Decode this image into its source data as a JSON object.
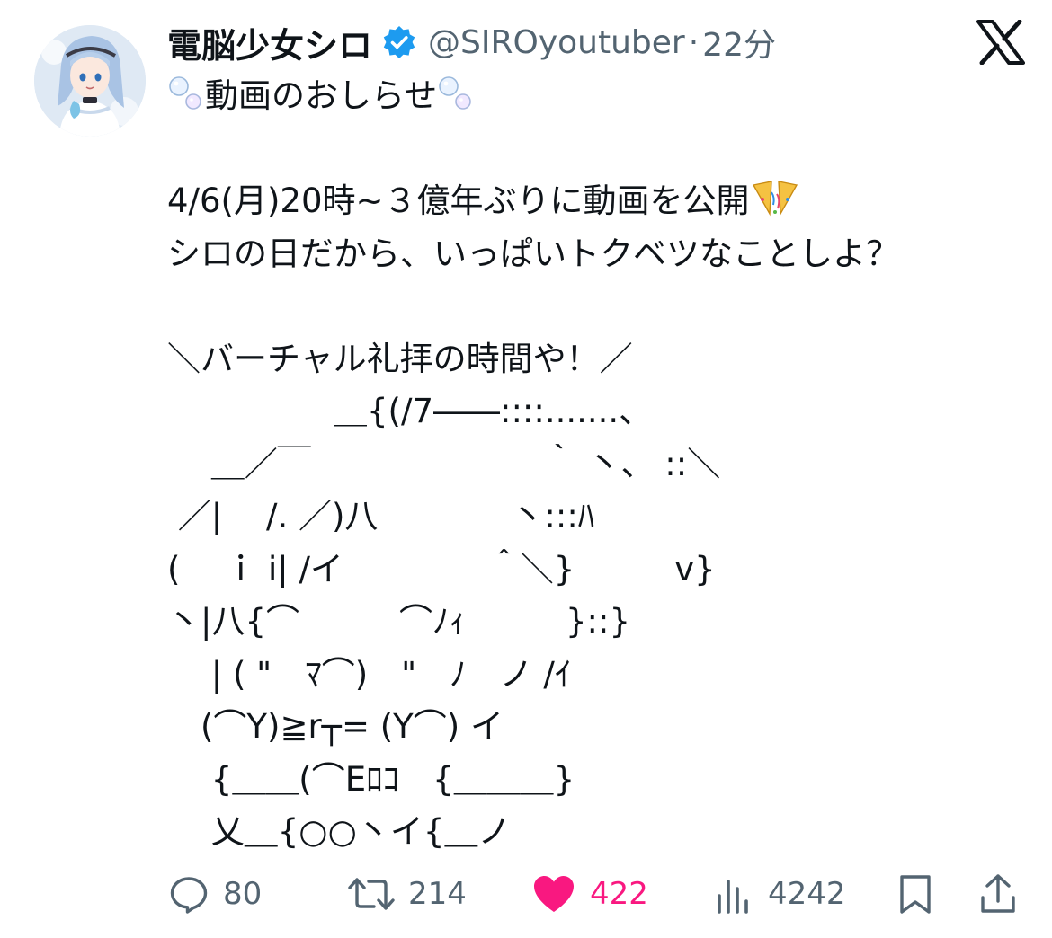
{
  "tweet": {
    "display_name": "電脳少女シロ",
    "handle": "@SIROyoutuber",
    "separator": "·",
    "time": "22分",
    "title_line": "動画のおしらせ",
    "line_schedule": "4/6(月)20時~３億年ぶりに動画を公開",
    "line_message": "シロの日だから、いっぱいトクベツなことしよ？",
    "line_catch": "＼バーチャル礼拝の時間や！／",
    "ascii_art": "　　　　　＿{(/7――::::.......、\n　 ＿／￣　　　　　　　｀ 丶、 ::＼\n ／|　 /. ／)八　　　　丶:::ﾊ\n(　 ｉ i| /イ　　　　 ＾＼}　　　v}\n丶|八{⌒　　　⌒ﾉｨ　　　}::}\n　 | ( \"　ﾏ⌒)　\"　ﾉ　ノ /ｲ\n　(⌒Y)≧r┬= (Y⌒) イ\n　 {＿＿(⌒Eﾛｺ　{＿＿＿}\n　 乂＿{○○丶イ{＿ノ"
  },
  "icons": {
    "brand": "x-logo-icon",
    "verified": "verified-badge-icon",
    "reply": "reply-icon",
    "retweet": "retweet-icon",
    "like": "heart-icon",
    "views": "views-icon",
    "bookmark": "bookmark-icon",
    "share": "share-icon"
  },
  "metrics": {
    "replies": "80",
    "retweets": "214",
    "likes": "422",
    "views": "4242"
  },
  "colors": {
    "text": "#0f1419",
    "secondary": "#536471",
    "verified": "#1d9bf0",
    "like": "#f91880"
  }
}
